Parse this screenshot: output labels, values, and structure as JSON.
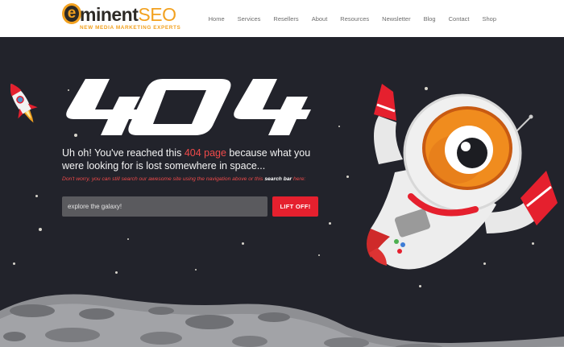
{
  "logo": {
    "letter": "e",
    "word": "minent",
    "seo": "SEO",
    "tagline": "NEW MEDIA MARKETING EXPERTS"
  },
  "nav": [
    "Home",
    "Services",
    "Resellers",
    "About",
    "Resources",
    "Newsletter",
    "Blog",
    "Contact",
    "Shop"
  ],
  "hero": {
    "title": "404",
    "headline_pre": "Uh oh! You've reached this ",
    "headline_highlight": "404 page",
    "headline_post": " because what you were looking for is lost somewhere in space...",
    "sub_pre": "Don't worry, you can still search our awesome site using the navigation above or this ",
    "sub_bold": "search bar",
    "sub_post": " here:"
  },
  "search": {
    "placeholder": "explore the galaxy!",
    "button_label": "LIFT OFF!"
  },
  "colors": {
    "accent": "#e5202e",
    "highlight": "#f04a4a",
    "brand": "#f2a11f",
    "background": "#22232b"
  },
  "icons": [
    "rocket-icon",
    "astronaut-illustration",
    "moon-surface"
  ]
}
